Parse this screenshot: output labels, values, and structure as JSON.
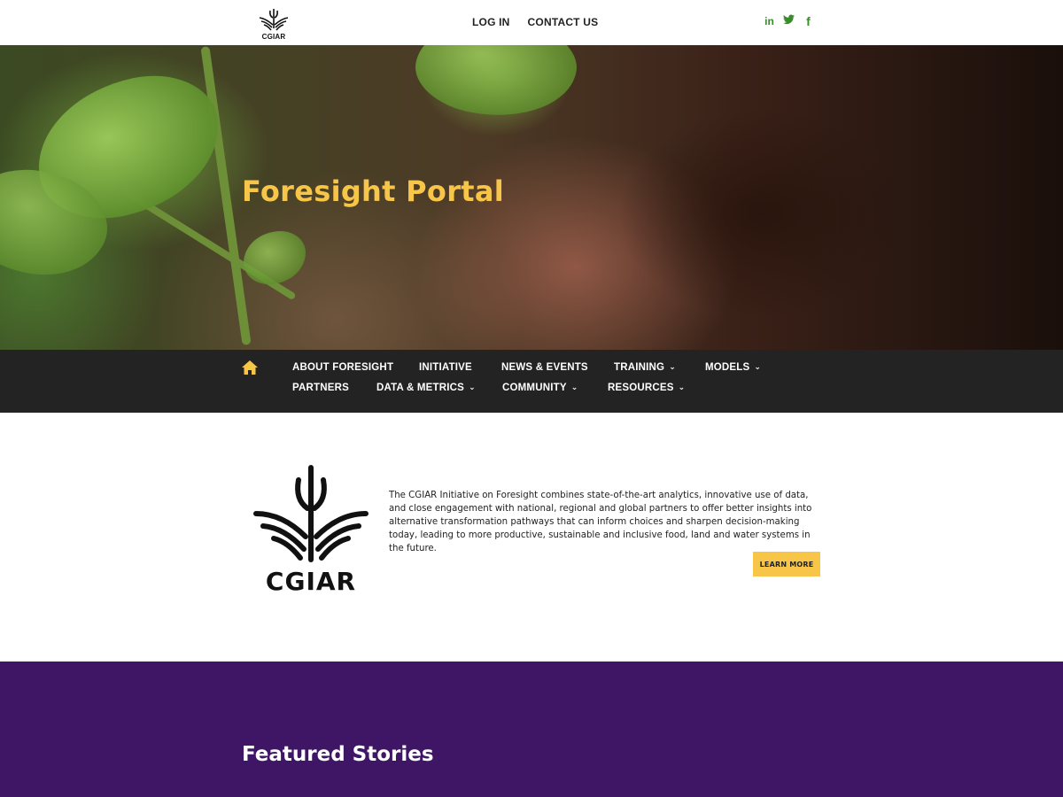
{
  "header": {
    "logo_text": "CGIAR",
    "links": [
      "LOG IN",
      "CONTACT US"
    ],
    "socials": [
      {
        "icon": "linkedin-icon",
        "glyph": "in"
      },
      {
        "icon": "twitter-icon",
        "glyph": "🐦"
      },
      {
        "icon": "facebook-icon",
        "glyph": "f"
      }
    ]
  },
  "hero": {
    "title": "Foresight Portal"
  },
  "nav": {
    "home_icon": "home-icon",
    "row1": [
      {
        "label": "ABOUT FORESIGHT",
        "dropdown": false
      },
      {
        "label": "INITIATIVE",
        "dropdown": false
      },
      {
        "label": "NEWS & EVENTS",
        "dropdown": false
      },
      {
        "label": "TRAINING",
        "dropdown": true
      },
      {
        "label": "MODELS",
        "dropdown": true
      }
    ],
    "row2": [
      {
        "label": "PARTNERS",
        "dropdown": false
      },
      {
        "label": "DATA & METRICS",
        "dropdown": true
      },
      {
        "label": "COMMUNITY",
        "dropdown": true
      },
      {
        "label": "RESOURCES",
        "dropdown": true
      }
    ]
  },
  "about": {
    "logo_text": "CGIAR",
    "text": "The CGIAR Initiative on Foresight combines state-of-the-art analytics, innovative use of data, and close engagement with national, regional and global partners to offer better insights into alternative transformation pathways that can inform choices and sharpen decision-making today, leading to more productive, sustainable and inclusive food, land and water systems in the future.",
    "button": "LEARN MORE"
  },
  "featured": {
    "title": "Featured Stories"
  },
  "colors": {
    "accent_yellow": "#f7c548",
    "nav_bg": "#232323",
    "featured_bg": "#3f1565",
    "social_green": "#3a8a2e"
  }
}
